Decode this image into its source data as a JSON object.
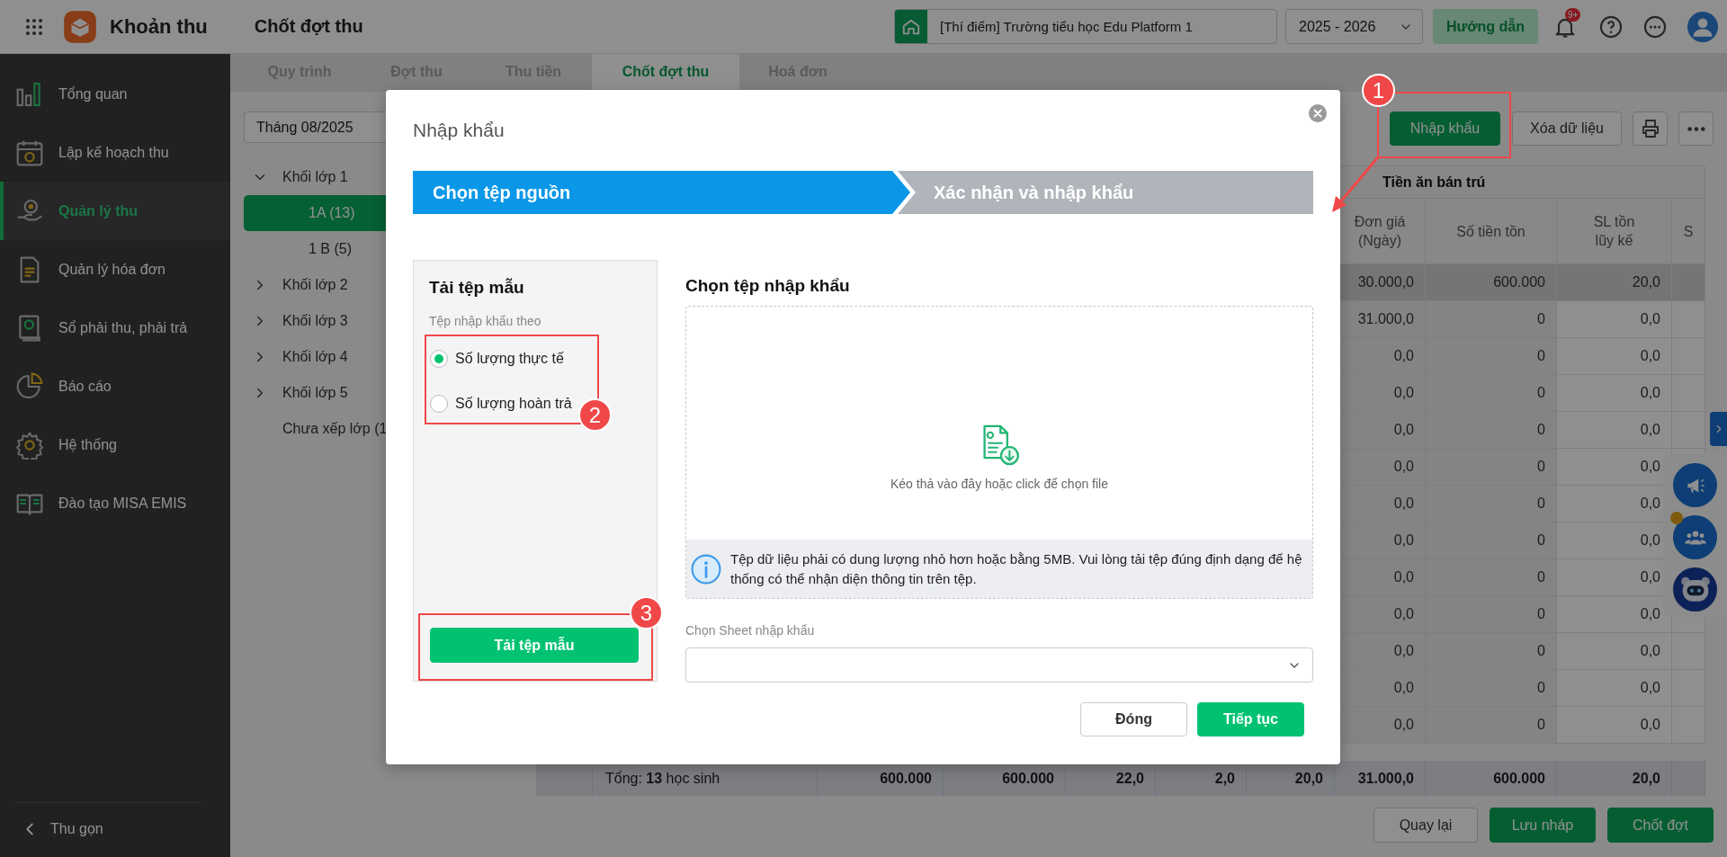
{
  "app": {
    "name": "Khoản thu",
    "page_title": "Chốt đợt thu"
  },
  "topbar": {
    "school": "[Thí điểm] Trường tiểu học Edu Platform 1",
    "year": "2025 - 2026",
    "guide_button": "Hướng dẫn",
    "notification_badge": "9+"
  },
  "sidebar": {
    "items": [
      {
        "label": "Tổng quan",
        "kind": "chart",
        "selected": false
      },
      {
        "label": "Lập kế hoạch thu",
        "kind": "calendar",
        "selected": false
      },
      {
        "label": "Quản lý thu",
        "kind": "hand",
        "selected": true
      },
      {
        "label": "Quản lý hóa đơn",
        "kind": "document",
        "selected": false
      },
      {
        "label": "Sổ phải thu, phải trả",
        "kind": "ledger",
        "selected": false
      },
      {
        "label": "Báo cáo",
        "kind": "pie",
        "selected": false
      },
      {
        "label": "Hệ thống",
        "kind": "gear",
        "selected": false
      },
      {
        "label": "Đào tạo MISA EMIS",
        "kind": "book",
        "selected": false
      }
    ],
    "collapse": "Thu gọn"
  },
  "tabs": [
    {
      "label": "Quy trình",
      "selected": false
    },
    {
      "label": "Đợt thu",
      "selected": false
    },
    {
      "label": "Thu tiền",
      "selected": false
    },
    {
      "label": "Chốt đợt thu",
      "selected": true
    },
    {
      "label": "Hoá đơn",
      "selected": false
    }
  ],
  "period": "Tháng 08/2025",
  "tree": [
    {
      "label": "Khối lớp 1",
      "expanded": true,
      "selected": false,
      "children": [
        {
          "label": "1A (13)",
          "selected": true
        },
        {
          "label": "1 B (5)",
          "selected": false
        }
      ]
    },
    {
      "label": "Khối lớp 2",
      "expanded": false,
      "selected": false
    },
    {
      "label": "Khối lớp 3",
      "expanded": false,
      "selected": false
    },
    {
      "label": "Khối lớp 4",
      "expanded": false,
      "selected": false
    },
    {
      "label": "Khối lớp 5",
      "expanded": false,
      "selected": false
    },
    {
      "label": "Chưa xếp lớp (1",
      "selected": false
    }
  ],
  "toolbar": {
    "import_button": "Nhập khẩu",
    "clear_button": "Xóa dữ liệu"
  },
  "table": {
    "group_header": "Tiền ăn bán trú",
    "columns": [
      "Đơn giá\n(Ngày)",
      "Số tiền tồn",
      "SL tồn\nlũy kế",
      "S"
    ],
    "rows": [
      {
        "selected": true,
        "cells": [
          "30.000,0",
          "600.000",
          "20,0"
        ]
      },
      {
        "selected": false,
        "cells": [
          "31.000,0",
          "0",
          "0,0"
        ]
      },
      {
        "selected": false,
        "cells": [
          "0,0",
          "0",
          "0,0"
        ]
      },
      {
        "selected": false,
        "cells": [
          "0,0",
          "0",
          "0,0"
        ]
      },
      {
        "selected": false,
        "cells": [
          "0,0",
          "0",
          "0,0"
        ]
      },
      {
        "selected": false,
        "cells": [
          "0,0",
          "0",
          "0,0"
        ]
      },
      {
        "selected": false,
        "cells": [
          "0,0",
          "0",
          "0,0"
        ]
      },
      {
        "selected": false,
        "cells": [
          "0,0",
          "0",
          "0,0"
        ]
      },
      {
        "selected": false,
        "cells": [
          "0,0",
          "0",
          "0,0"
        ]
      },
      {
        "selected": false,
        "cells": [
          "0,0",
          "0",
          "0,0"
        ]
      },
      {
        "selected": false,
        "cells": [
          "0,0",
          "0",
          "0,0"
        ]
      },
      {
        "selected": false,
        "cells": [
          "0,0",
          "0",
          "0,0"
        ]
      },
      {
        "selected": false,
        "cells": [
          "0,0",
          "0",
          "0,0"
        ]
      }
    ],
    "total": {
      "label": "Tổng: **13** học sinh",
      "values": [
        "600.000",
        "600.000",
        "22,0",
        "2,0",
        "20,0",
        "31.000,0",
        "600.000",
        "20,0"
      ]
    }
  },
  "footer_buttons": [
    {
      "label": "Quay lại",
      "kind": "secondary"
    },
    {
      "label": "Lưu nháp",
      "kind": "primary"
    },
    {
      "label": "Chốt đợt",
      "kind": "primary"
    }
  ],
  "modal": {
    "title": "Nhập khẩu",
    "steps": [
      {
        "label": "Chọn tệp nguồn",
        "selected": true
      },
      {
        "label": "Xác nhận và nhập khẩu",
        "selected": false
      }
    ],
    "template_panel": {
      "title": "Tải tệp mẫu",
      "subtitle": "Tệp nhập khẩu theo",
      "options": [
        {
          "label": "Số lượng thực tế",
          "selected": true
        },
        {
          "label": "Số lượng hoàn trả",
          "selected": false
        }
      ],
      "button": "Tải tệp mẫu"
    },
    "file_section": {
      "title": "Chọn tệp nhập khẩu",
      "drop_hint": "Kéo thả vào đây hoặc click để chọn file",
      "info": "Tệp dữ liệu phải có dung lượng nhỏ hơn hoặc bằng 5MB. Vui lòng tải tệp đúng định dạng để hệ thống có thể nhận diện thông tin trên tệp.",
      "sheet_label": "Chọn Sheet nhập khẩu"
    },
    "buttons": [
      {
        "label": "Đóng",
        "kind": "secondary"
      },
      {
        "label": "Tiếp tục",
        "kind": "primary"
      }
    ]
  },
  "annotations": [
    {
      "number": "1"
    },
    {
      "number": "2"
    },
    {
      "number": "3"
    }
  ]
}
